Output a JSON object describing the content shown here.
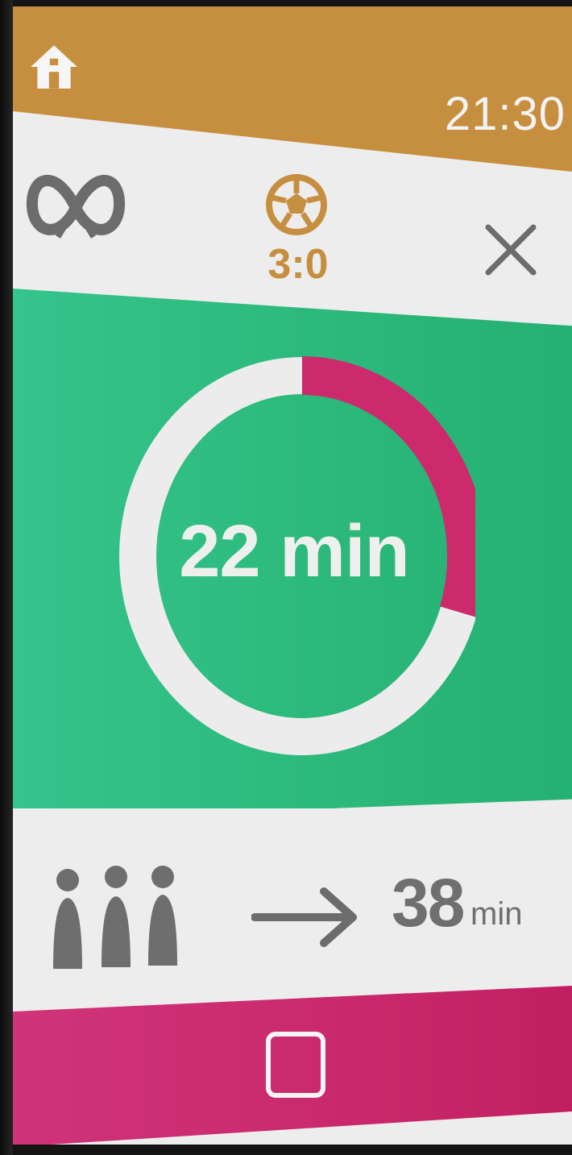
{
  "status_bar": {
    "time": "21:30",
    "home_icon": "home-icon"
  },
  "header": {
    "venue_icon": "pretzel-icon",
    "sport_icon": "soccer-ball-icon",
    "score": "3:0",
    "close_icon": "close-icon"
  },
  "timer": {
    "label": "22 min",
    "elapsed_fraction": 0.3
  },
  "queue": {
    "people_icon": "people-icon",
    "arrow_icon": "arrow-right-icon",
    "wait_value": "38",
    "wait_unit": "min"
  },
  "nav": {
    "home_button_icon": "square-home-icon"
  },
  "colors": {
    "gold": "#c68f3f",
    "green": "#2cb97b",
    "magenta": "#c9296c",
    "light": "#ededed",
    "gray": "#6f6f6f"
  }
}
